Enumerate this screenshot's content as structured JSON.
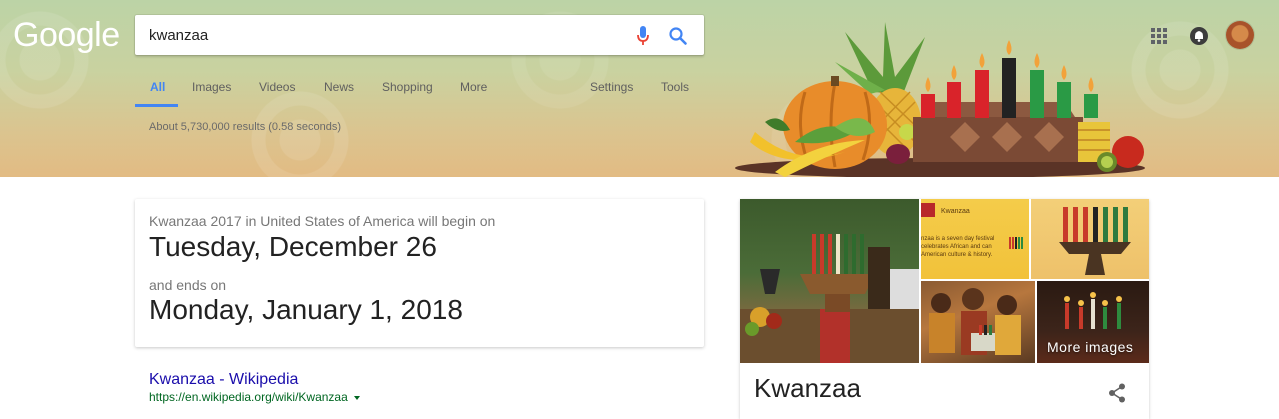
{
  "header": {
    "logo": "Google",
    "search": {
      "value": "kwanzaa"
    },
    "tabs": [
      {
        "label": "All",
        "active": true
      },
      {
        "label": "Images"
      },
      {
        "label": "Videos"
      },
      {
        "label": "News"
      },
      {
        "label": "Shopping"
      },
      {
        "label": "More"
      },
      {
        "label": "Settings"
      },
      {
        "label": "Tools"
      }
    ],
    "result_stats": "About 5,730,000 results (0.58 seconds)",
    "icons": [
      "mic-icon",
      "search-icon",
      "apps-grid-icon",
      "notifications-bell-icon",
      "avatar"
    ]
  },
  "date_card": {
    "intro": "Kwanzaa 2017 in United States of America will begin on",
    "start": "Tuesday, December 26",
    "mid": "and ends on",
    "end": "Monday, January 1, 2018"
  },
  "result": {
    "title": "Kwanzaa - Wikipedia",
    "url": "https://en.wikipedia.org/wiki/Kwanzaa"
  },
  "knowledge_panel": {
    "more_images": "More images",
    "title": "Kwanzaa",
    "banner_heading": "Kwanzaa",
    "banner_text": "nzaa is a seven day festival celebrates African and can American culture & history."
  },
  "colors": {
    "accent": "#4285f4",
    "link": "#1a0dab",
    "url": "#006621"
  }
}
